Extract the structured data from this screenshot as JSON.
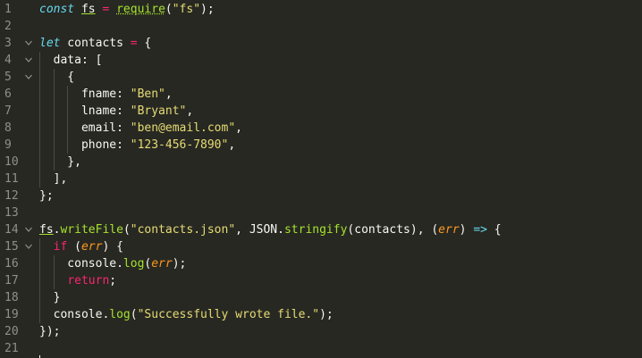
{
  "editor": {
    "lines": [
      {
        "n": "1",
        "fold": "",
        "tokens": [
          {
            "t": "const",
            "c": "t-keyword"
          },
          {
            "t": " ",
            "c": "t-punct"
          },
          {
            "t": "fs",
            "c": "t-fs"
          },
          {
            "t": " ",
            "c": "t-punct"
          },
          {
            "t": "=",
            "c": "t-op"
          },
          {
            "t": " ",
            "c": "t-punct"
          },
          {
            "t": "require",
            "c": "t-squiggle"
          },
          {
            "t": "(",
            "c": "t-punct"
          },
          {
            "t": "\"fs\"",
            "c": "t-string"
          },
          {
            "t": ");",
            "c": "t-punct"
          }
        ]
      },
      {
        "n": "2",
        "fold": "",
        "tokens": []
      },
      {
        "n": "3",
        "fold": "v",
        "tokens": [
          {
            "t": "let",
            "c": "t-keyword"
          },
          {
            "t": " contacts ",
            "c": "t-ident"
          },
          {
            "t": "=",
            "c": "t-op"
          },
          {
            "t": " {",
            "c": "t-punct"
          }
        ]
      },
      {
        "n": "4",
        "fold": "v",
        "tokens": [
          {
            "t": "  data: [",
            "c": "t-ident"
          }
        ]
      },
      {
        "n": "5",
        "fold": "v",
        "tokens": [
          {
            "t": "    {",
            "c": "t-punct"
          }
        ]
      },
      {
        "n": "6",
        "fold": "",
        "tokens": [
          {
            "t": "      fname: ",
            "c": "t-ident"
          },
          {
            "t": "\"Ben\"",
            "c": "t-string"
          },
          {
            "t": ",",
            "c": "t-punct"
          }
        ]
      },
      {
        "n": "7",
        "fold": "",
        "tokens": [
          {
            "t": "      lname: ",
            "c": "t-ident"
          },
          {
            "t": "\"Bryant\"",
            "c": "t-string"
          },
          {
            "t": ",",
            "c": "t-punct"
          }
        ]
      },
      {
        "n": "8",
        "fold": "",
        "tokens": [
          {
            "t": "      email: ",
            "c": "t-ident"
          },
          {
            "t": "\"ben@email.com\"",
            "c": "t-string"
          },
          {
            "t": ",",
            "c": "t-punct"
          }
        ]
      },
      {
        "n": "9",
        "fold": "",
        "tokens": [
          {
            "t": "      phone: ",
            "c": "t-ident"
          },
          {
            "t": "\"123-456-7890\"",
            "c": "t-string"
          },
          {
            "t": ",",
            "c": "t-punct"
          }
        ]
      },
      {
        "n": "10",
        "fold": "",
        "tokens": [
          {
            "t": "    },",
            "c": "t-punct"
          }
        ]
      },
      {
        "n": "11",
        "fold": "",
        "tokens": [
          {
            "t": "  ],",
            "c": "t-punct"
          }
        ]
      },
      {
        "n": "12",
        "fold": "",
        "tokens": [
          {
            "t": "};",
            "c": "t-punct"
          }
        ]
      },
      {
        "n": "13",
        "fold": "",
        "tokens": []
      },
      {
        "n": "14",
        "fold": "v",
        "tokens": [
          {
            "t": "fs",
            "c": "t-fs"
          },
          {
            "t": ".",
            "c": "t-punct"
          },
          {
            "t": "writeFile",
            "c": "t-func"
          },
          {
            "t": "(",
            "c": "t-punct"
          },
          {
            "t": "\"contacts.json\"",
            "c": "t-string"
          },
          {
            "t": ", JSON.",
            "c": "t-ident"
          },
          {
            "t": "stringify",
            "c": "t-func"
          },
          {
            "t": "(contacts), (",
            "c": "t-ident"
          },
          {
            "t": "err",
            "c": "t-param"
          },
          {
            "t": ") ",
            "c": "t-punct"
          },
          {
            "t": "=>",
            "c": "t-keyword"
          },
          {
            "t": " {",
            "c": "t-punct"
          }
        ]
      },
      {
        "n": "15",
        "fold": "v",
        "tokens": [
          {
            "t": "  ",
            "c": "t-punct"
          },
          {
            "t": "if",
            "c": "t-flow"
          },
          {
            "t": " (",
            "c": "t-punct"
          },
          {
            "t": "err",
            "c": "t-param"
          },
          {
            "t": ") {",
            "c": "t-punct"
          }
        ]
      },
      {
        "n": "16",
        "fold": "",
        "tokens": [
          {
            "t": "    console.",
            "c": "t-ident"
          },
          {
            "t": "log",
            "c": "t-func"
          },
          {
            "t": "(",
            "c": "t-punct"
          },
          {
            "t": "err",
            "c": "t-param"
          },
          {
            "t": ");",
            "c": "t-punct"
          }
        ]
      },
      {
        "n": "17",
        "fold": "",
        "tokens": [
          {
            "t": "    ",
            "c": "t-punct"
          },
          {
            "t": "return",
            "c": "t-flow"
          },
          {
            "t": ";",
            "c": "t-punct"
          }
        ]
      },
      {
        "n": "18",
        "fold": "",
        "tokens": [
          {
            "t": "  }",
            "c": "t-punct"
          }
        ]
      },
      {
        "n": "19",
        "fold": "",
        "tokens": [
          {
            "t": "  console.",
            "c": "t-ident"
          },
          {
            "t": "log",
            "c": "t-func"
          },
          {
            "t": "(",
            "c": "t-punct"
          },
          {
            "t": "\"Successfully wrote file.\"",
            "c": "t-string"
          },
          {
            "t": ");",
            "c": "t-punct"
          }
        ]
      },
      {
        "n": "20",
        "fold": "",
        "tokens": [
          {
            "t": "});",
            "c": "t-punct"
          }
        ]
      },
      {
        "n": "21",
        "fold": "",
        "tokens": []
      }
    ]
  },
  "colors": {
    "background": "#272822",
    "keyword": "#66d9ef",
    "operator": "#f92672",
    "string": "#e6db74",
    "function": "#a6e22e",
    "parameter": "#fd971f",
    "text": "#f8f8f2",
    "line_number": "#90908a"
  }
}
